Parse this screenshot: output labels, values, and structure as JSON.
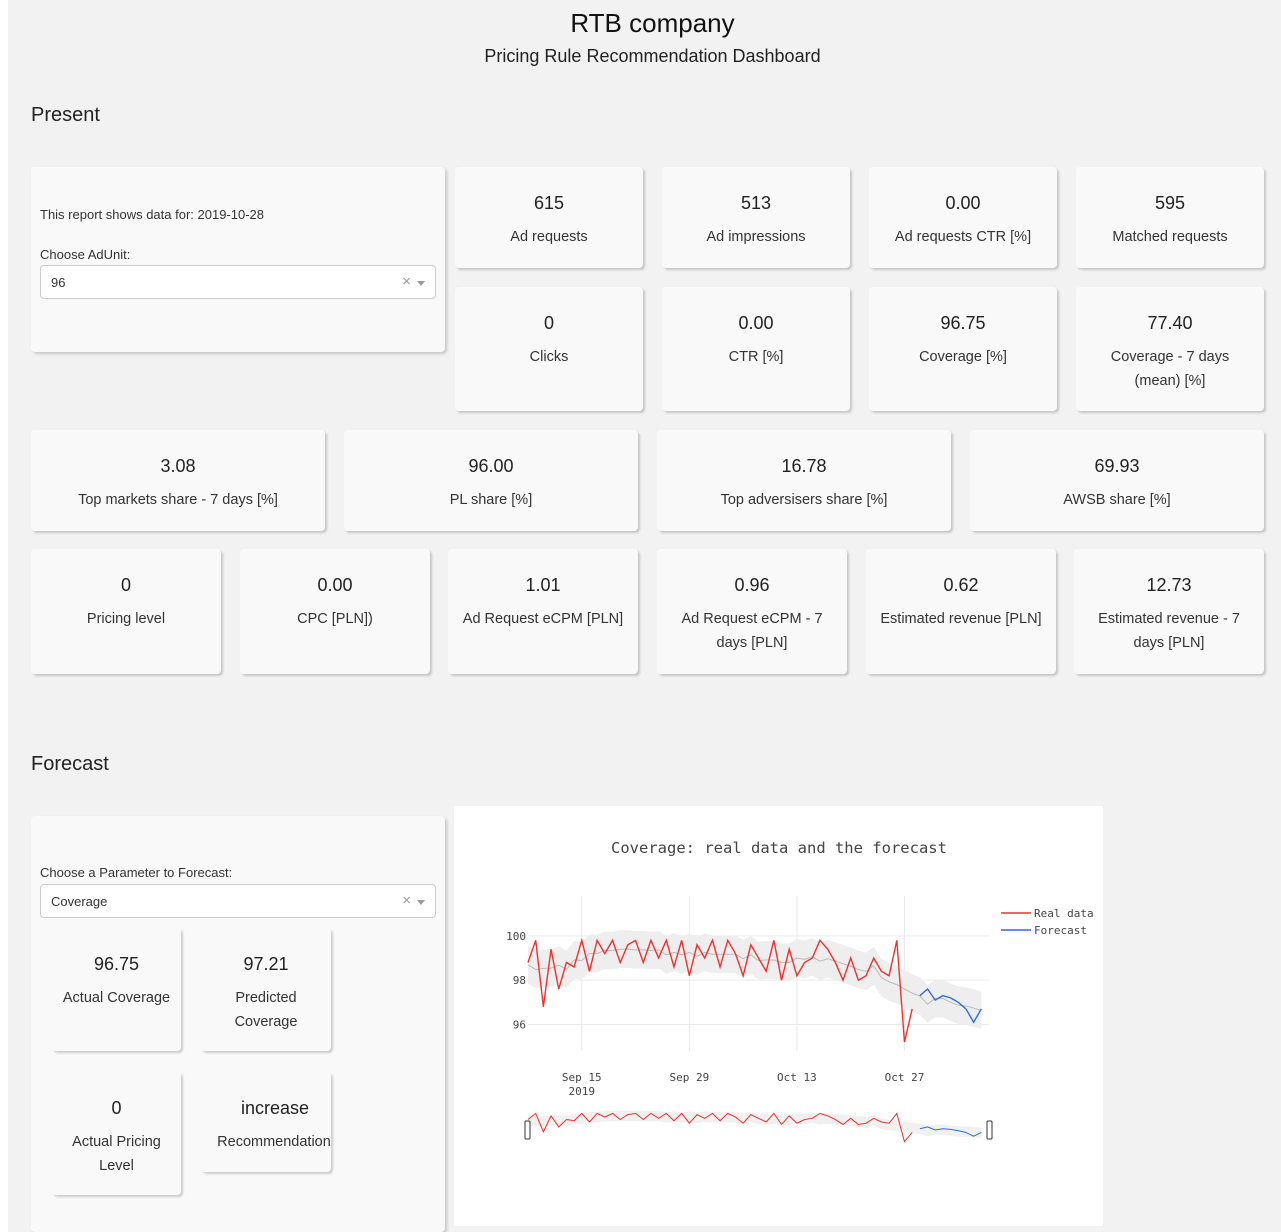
{
  "header": {
    "title": "RTB company",
    "subtitle": "Pricing Rule Recommendation Dashboard"
  },
  "present": {
    "heading": "Present",
    "report_text": "This report shows data for: 2019-10-28",
    "adunit_label": "Choose AdUnit:",
    "adunit_value": "96",
    "metrics": [
      {
        "value": "615",
        "label": "Ad requests"
      },
      {
        "value": "513",
        "label": "Ad impressions"
      },
      {
        "value": "0.00",
        "label": "Ad requests CTR [%]"
      },
      {
        "value": "595",
        "label": "Matched requests"
      },
      {
        "value": "0",
        "label": "Clicks"
      },
      {
        "value": "0.00",
        "label": "CTR [%]"
      },
      {
        "value": "96.75",
        "label": "Coverage [%]"
      },
      {
        "value": "77.40",
        "label": "Coverage - 7 days (mean) [%]"
      }
    ],
    "shares": [
      {
        "value": "3.08",
        "label": "Top markets share - 7 days [%]"
      },
      {
        "value": "96.00",
        "label": "PL share [%]"
      },
      {
        "value": "16.78",
        "label": "Top adversisers share [%]"
      },
      {
        "value": "69.93",
        "label": "AWSB share [%]"
      }
    ],
    "pricing": [
      {
        "value": "0",
        "label": "Pricing level"
      },
      {
        "value": "0.00",
        "label": "CPC [PLN])"
      },
      {
        "value": "1.01",
        "label": "Ad Request eCPM [PLN]"
      },
      {
        "value": "0.96",
        "label": "Ad Request eCPM - 7 days [PLN]"
      },
      {
        "value": "0.62",
        "label": "Estimated revenue [PLN]"
      },
      {
        "value": "12.73",
        "label": "Estimated revenue - 7 days [PLN]"
      }
    ]
  },
  "forecast": {
    "heading": "Forecast",
    "param_label": "Choose a Parameter to Forecast:",
    "param_value": "Coverage",
    "cards": [
      {
        "value": "96.75",
        "label": "Actual Coverage"
      },
      {
        "value": "97.21",
        "label": "Predicted Coverage"
      },
      {
        "value": "0",
        "label": "Actual Pricing Level"
      },
      {
        "value": "increase",
        "label": "Recommendation"
      }
    ]
  },
  "colors": {
    "real_data": "#f0302c",
    "forecast": "#2f6be0",
    "band": "#eeeeee",
    "trend": "#bbbbbb"
  },
  "icons": {
    "clear": "close-icon",
    "dropdown": "chevron-down-icon"
  },
  "chart_data": {
    "type": "line",
    "title": "Coverage: real data and the forecast",
    "xlabel": "",
    "ylabel": "",
    "x_ticks": [
      "Sep 15\n2019",
      "Sep 29",
      "Oct 13",
      "Oct 27"
    ],
    "y_ticks": [
      96,
      98,
      100
    ],
    "ylim": [
      94.8,
      100.9
    ],
    "xlim": [
      "2019-09-08",
      "2019-11-01"
    ],
    "legend_position": "top-right",
    "grid": true,
    "range_slider": true,
    "series": [
      {
        "name": "Real data",
        "color": "#f0302c",
        "x": [
          "2019-09-08",
          "2019-09-09",
          "2019-09-10",
          "2019-09-11",
          "2019-09-12",
          "2019-09-13",
          "2019-09-14",
          "2019-09-15",
          "2019-09-16",
          "2019-09-17",
          "2019-09-18",
          "2019-09-19",
          "2019-09-20",
          "2019-09-21",
          "2019-09-22",
          "2019-09-23",
          "2019-09-24",
          "2019-09-25",
          "2019-09-26",
          "2019-09-27",
          "2019-09-28",
          "2019-09-29",
          "2019-09-30",
          "2019-10-01",
          "2019-10-02",
          "2019-10-03",
          "2019-10-04",
          "2019-10-05",
          "2019-10-06",
          "2019-10-07",
          "2019-10-08",
          "2019-10-09",
          "2019-10-10",
          "2019-10-11",
          "2019-10-12",
          "2019-10-13",
          "2019-10-14",
          "2019-10-15",
          "2019-10-16",
          "2019-10-17",
          "2019-10-18",
          "2019-10-19",
          "2019-10-20",
          "2019-10-21",
          "2019-10-22",
          "2019-10-23",
          "2019-10-24",
          "2019-10-25",
          "2019-10-26",
          "2019-10-27",
          "2019-10-28"
        ],
        "y": [
          98.8,
          99.8,
          96.8,
          99.4,
          97.6,
          98.8,
          98.6,
          99.8,
          98.4,
          99.8,
          99.2,
          99.8,
          98.8,
          99.6,
          99.8,
          98.8,
          99.8,
          99.0,
          99.8,
          98.6,
          99.8,
          98.2,
          99.6,
          99.0,
          99.8,
          98.6,
          99.8,
          99.2,
          98.2,
          99.6,
          99.0,
          98.4,
          99.8,
          98.0,
          99.4,
          98.2,
          98.8,
          99.0,
          99.8,
          99.4,
          98.8,
          98.0,
          99.0,
          98.0,
          98.2,
          99.0,
          98.4,
          98.2,
          99.8,
          95.2,
          96.7
        ]
      },
      {
        "name": "Forecast",
        "color": "#2f6be0",
        "x": [
          "2019-10-29",
          "2019-10-30",
          "2019-10-31",
          "2019-11-01",
          "2019-11-02",
          "2019-11-03",
          "2019-11-04",
          "2019-11-05",
          "2019-11-06"
        ],
        "y": [
          97.3,
          97.6,
          97.1,
          97.3,
          97.2,
          97.0,
          96.7,
          96.1,
          96.7
        ]
      }
    ]
  }
}
